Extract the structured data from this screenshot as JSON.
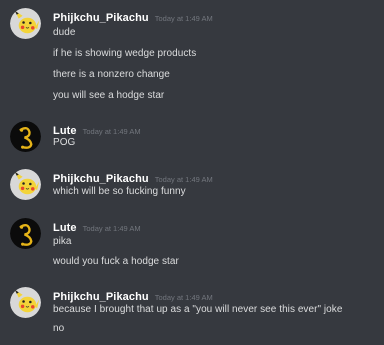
{
  "messages": [
    {
      "username": "Phijkchu_Pikachu",
      "timestamp": "Today at 1:49 AM",
      "avatar": "pikachu-avatar",
      "lines": [
        "dude",
        "if he is showing wedge products",
        "there is a nonzero change",
        "you will see a hodge star"
      ]
    },
    {
      "username": "Lute",
      "timestamp": "Today at 1:49 AM",
      "avatar": "lute-avatar",
      "lines": [
        "POG"
      ]
    },
    {
      "username": "Phijkchu_Pikachu",
      "timestamp": "Today at 1:49 AM",
      "avatar": "pikachu-avatar",
      "lines": [
        "which will be so fucking funny"
      ]
    },
    {
      "username": "Lute",
      "timestamp": "Today at 1:49 AM",
      "avatar": "lute-avatar",
      "lines": [
        "pika",
        "would you fuck a hodge star"
      ]
    },
    {
      "username": "Phijkchu_Pikachu",
      "timestamp": "Today at 1:49 AM",
      "avatar": "pikachu-avatar",
      "lines": [
        "because I brought that up as a \"you will never see this ever\" joke",
        "no"
      ]
    }
  ],
  "colors": {
    "background": "#36393f",
    "username": "#ffffff",
    "timestamp": "#72767d",
    "message_text": "#dcddde",
    "pikachu_avatar_bg": "#d8d8d8",
    "pikachu_yellow": "#f3d438",
    "lute_avatar_bg": "#0b0b0b",
    "lute_gold": "#e6b418"
  }
}
